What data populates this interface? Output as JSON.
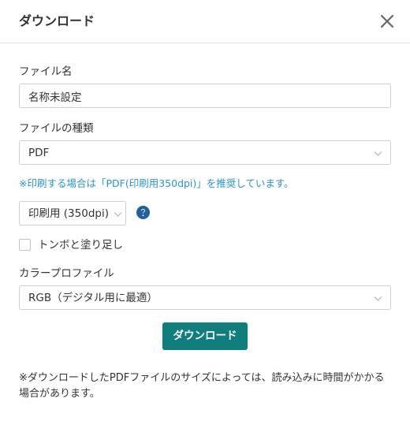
{
  "dialog": {
    "title": "ダウンロード",
    "close_icon": "close-icon"
  },
  "filename": {
    "label": "ファイル名",
    "value": "名称未設定"
  },
  "filetype": {
    "label": "ファイルの種類",
    "selected": "PDF",
    "icon": "chevron-down-icon"
  },
  "recommendation_note": "※印刷する場合は「PDF(印刷用350dpi)」を推奨しています。",
  "resolution": {
    "selected": "印刷用 (350dpi)",
    "help_icon": "question-circle-icon"
  },
  "crop_marks": {
    "label": "トンボと塗り足し",
    "checked": false
  },
  "color_profile": {
    "label": "カラープロファイル",
    "selected": "RGB（デジタル用に最適）"
  },
  "download_button": {
    "label": "ダウンロード"
  },
  "footer_note": "※ダウンロードしたPDFファイルのサイズによっては、読み込みに時間がかかる場合があります。",
  "colors": {
    "accent": "#117e7e",
    "note_blue": "#2a93c9",
    "help_blue": "#1f5f9e"
  }
}
